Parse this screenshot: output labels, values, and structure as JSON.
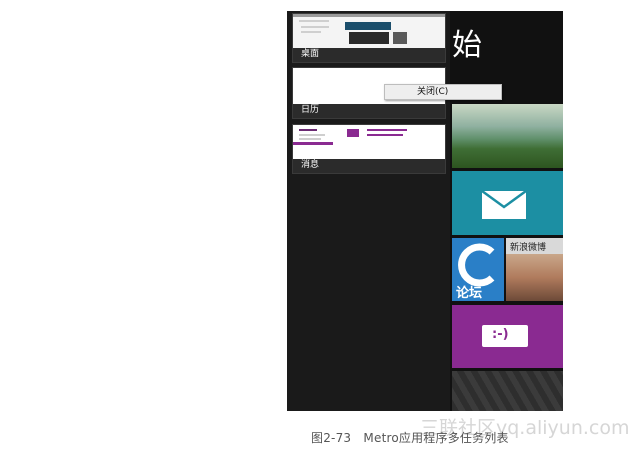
{
  "switcher": {
    "items": [
      {
        "label": "桌面"
      },
      {
        "label": "日历"
      },
      {
        "label": "消息"
      }
    ]
  },
  "context_menu": {
    "close_label": "关闭(C)"
  },
  "start": {
    "title": "始",
    "tiles": {
      "weibo_label": "新浪微博",
      "forum_label": "论坛",
      "message_glyph": ":-)"
    }
  },
  "caption": "图2-73　Metro应用程序多任务列表",
  "watermark": "三联社区yq.aliyun.com",
  "colors": {
    "mail_tile": "#1c8fa3",
    "message_tile": "#8a2a91",
    "forum_tile": "#2a7fc7",
    "screen_bg": "#141414"
  }
}
